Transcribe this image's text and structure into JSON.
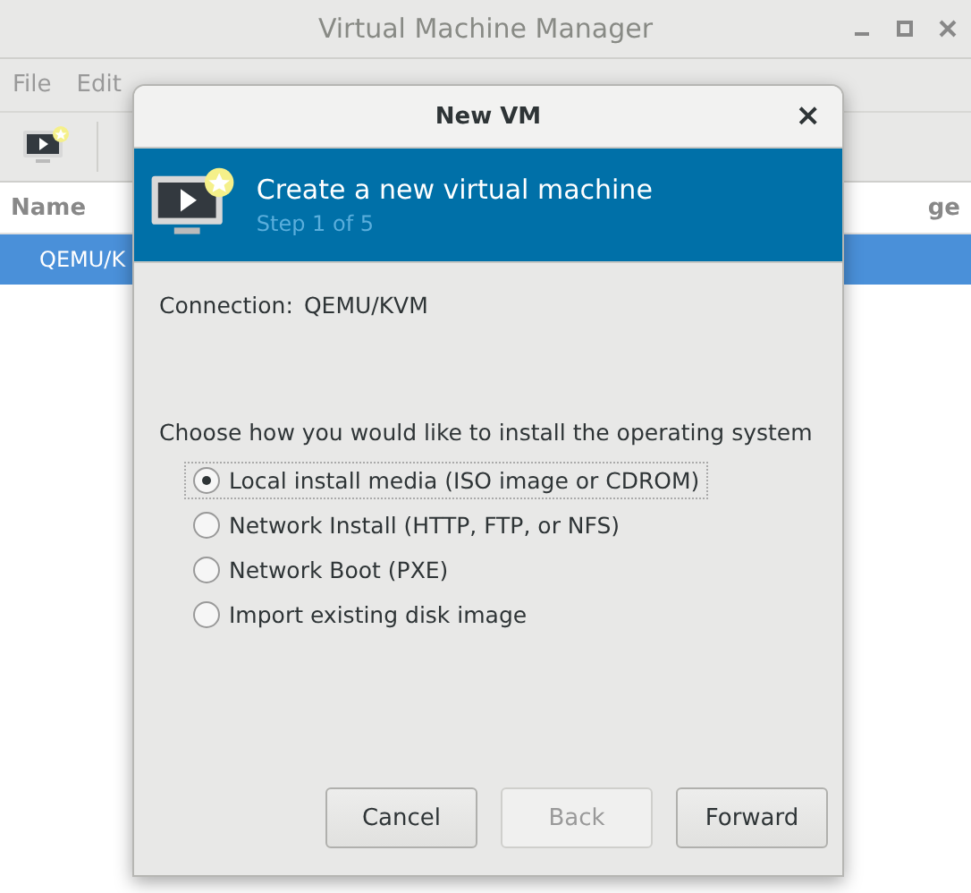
{
  "window": {
    "title": "Virtual Machine Manager"
  },
  "menu": [
    {
      "label": "File"
    },
    {
      "label": "Edit"
    }
  ],
  "list": {
    "columns": [
      "Name",
      "ge"
    ],
    "rows": [
      {
        "name": "QEMU/K",
        "selected": true
      }
    ]
  },
  "dialog": {
    "title": "New VM",
    "close": "×",
    "banner": {
      "title": "Create a new virtual machine",
      "subtitle": "Step 1 of 5"
    },
    "connection": {
      "label": "Connection:",
      "value": "QEMU/KVM"
    },
    "prompt": "Choose how you would like to install the operating system",
    "options": [
      {
        "label": "Local install media (ISO image or CDROM)",
        "selected": true
      },
      {
        "label": "Network Install (HTTP, FTP, or NFS)",
        "selected": false
      },
      {
        "label": "Network Boot (PXE)",
        "selected": false
      },
      {
        "label": "Import existing disk image",
        "selected": false
      }
    ],
    "buttons": [
      {
        "label": "Cancel",
        "disabled": false
      },
      {
        "label": "Back",
        "disabled": true
      },
      {
        "label": "Forward",
        "disabled": false
      }
    ]
  }
}
